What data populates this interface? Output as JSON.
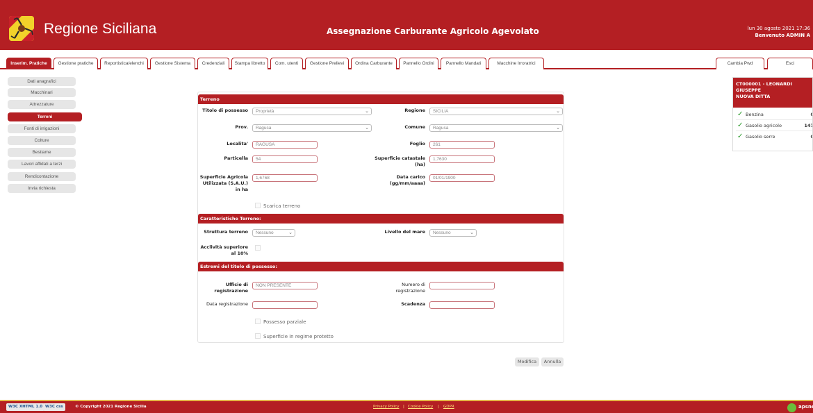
{
  "header": {
    "brand": "Regione Siciliana",
    "app_title": "Assegnazione Carburante Agricolo Agevolato",
    "datetime": "lun 30 agosto 2021 17:36",
    "welcome": "Benvenuto ADMIN A"
  },
  "nav": {
    "tabs": [
      {
        "label": "Inserim. Pratiche"
      },
      {
        "label": "Gestione pratiche"
      },
      {
        "label": "Reportistica/elenchi"
      },
      {
        "label": "Gestione Sistema"
      },
      {
        "label": "Credenziali"
      },
      {
        "label": "Stampa libretto"
      },
      {
        "label": "Com. utenti"
      },
      {
        "label": "Gestione Prelievi"
      },
      {
        "label": "Ordina Carburante"
      },
      {
        "label": "Pannello Ordini"
      },
      {
        "label": "Pannello Mandati"
      },
      {
        "label": "Macchine Irroratrici"
      }
    ],
    "right_tabs": [
      {
        "label": "Cambia Pwd"
      },
      {
        "label": "Esci"
      }
    ]
  },
  "sidebar": {
    "items": [
      {
        "label": "Dati anagrafici"
      },
      {
        "label": "Macchinari"
      },
      {
        "label": "Attrezzature"
      },
      {
        "label": "Terreni"
      },
      {
        "label": "Fonti di irrigazioni"
      },
      {
        "label": "Colture"
      },
      {
        "label": "Bestiame"
      },
      {
        "label": "Lavori affidati a terzi"
      },
      {
        "label": "Rendicontazione"
      },
      {
        "label": "Invia richiesta"
      }
    ]
  },
  "form": {
    "section_terreno": "Terreno",
    "titolo_label": "Titolo di possesso",
    "titolo_value": "Proprietà",
    "regione_label": "Regione",
    "regione_value": "SICILIA",
    "prov_label": "Prov.",
    "prov_value": "Ragusa",
    "comune_label": "Comune",
    "comune_value": "Ragusa",
    "localita_label": "Localita'",
    "localita_value": "RAGUSA",
    "foglio_label": "Foglio",
    "foglio_value": "261",
    "particella_label": "Particella",
    "particella_value": "54",
    "sup_catastale_label": "Superficie catastale (ha)",
    "sup_catastale_value": "1,7630",
    "sau_label": "Superficie Agricola Utilizzata (S.A.U.) in ha",
    "sau_value": "1,6768",
    "data_carico_label": "Data carico (gg/mm/aaaa)",
    "data_carico_value": "01/01/1900",
    "scarica_label": "Scarica terreno",
    "section_caratteristiche": "Caratteristiche Terreno:",
    "struttura_label": "Struttura terreno",
    "struttura_value": "Nessuno",
    "livello_label": "Livello del mare",
    "livello_value": "Nessuno",
    "acclivita_label": "Acclività superiore al 10%",
    "section_estremi": "Estremi del titolo di possesso:",
    "ufficio_label": "Ufficio di registrazione",
    "ufficio_value": "NON PRESENTE",
    "numero_label": "Numero di registrazione",
    "numero_value": "",
    "data_reg_label": "Data registrazione",
    "data_reg_value": "",
    "scadenza_label": "Scadenza",
    "scadenza_value": "",
    "possesso_label": "Possesso parziale",
    "regime_label": "Superficie in regime protetto"
  },
  "actions": {
    "modifica": "Modifica",
    "annulla": "Annulla"
  },
  "card": {
    "title_line1": "CT000001 - LEONARDI",
    "title_line2": "GIUSEPPE",
    "title_line3": "NUOVA DITTA",
    "fuels": [
      {
        "name": "Benzina",
        "value": "0"
      },
      {
        "name": "Gasolio agricolo",
        "value": "147"
      },
      {
        "name": "Gasolio serre",
        "value": "0"
      }
    ]
  },
  "footer": {
    "w3c_xhtml": "W3C XHTML 1.0",
    "w3c_css": "W3C css",
    "copyright": "© Copyright 2021 Regione Sicilia",
    "privacy": "Privacy Policy",
    "cookie": "Cookie Policy",
    "gdpr": "GDPR",
    "sep": "|",
    "apsnet": "apsnet"
  },
  "colors": {
    "brand_red": "#b41f23",
    "check_green": "#2b9a2b",
    "footer_gold": "#e6b84a"
  }
}
